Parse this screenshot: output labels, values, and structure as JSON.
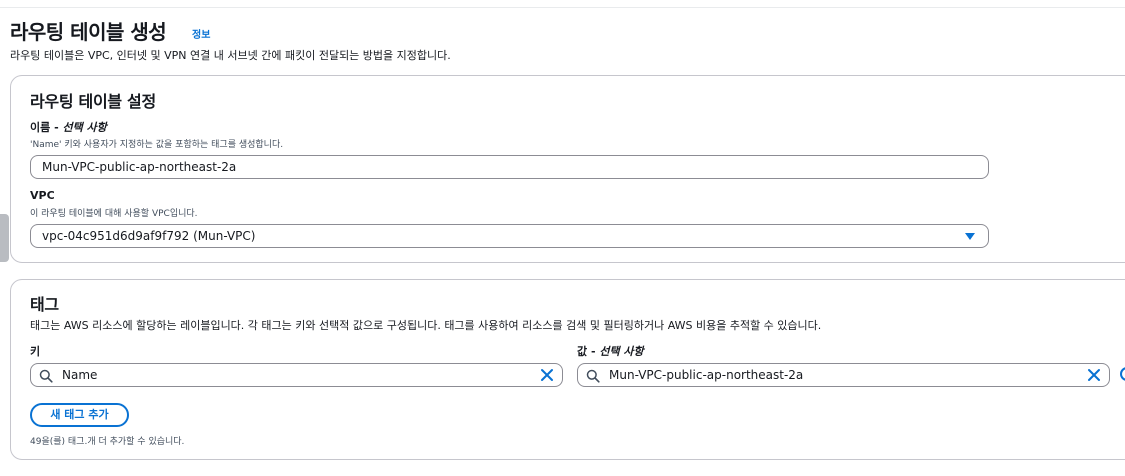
{
  "header": {
    "title": "라우팅 테이블 생성",
    "info_link": "정보",
    "description": "라우팅 테이블은 VPC, 인터넷 및 VPN 연결 내 서브넷 간에 패킷이 전달되는 방법을 지정합니다."
  },
  "settings": {
    "title": "라우팅 테이블 설정",
    "name_label": "이름 - ",
    "name_optional": "선택 사항",
    "name_hint": "'Name' 키와 사용자가 지정하는 값을 포함하는 태그를 생성합니다.",
    "name_value": "Mun-VPC-public-ap-northeast-2a",
    "vpc_label": "VPC",
    "vpc_hint": "이 라우팅 테이블에 대해 사용할 VPC입니다.",
    "vpc_value": "vpc-04c951d6d9af9f792 (Mun-VPC)"
  },
  "tags": {
    "title": "태그",
    "description": "태그는 AWS 리소스에 할당하는 레이블입니다. 각 태그는 키와 선택적 값으로 구성됩니다. 태그를 사용하여 리소스를 검색 및 필터링하거나 AWS 비용을 추적할 수 있습니다.",
    "key_label": "키",
    "value_label": "값 - ",
    "value_optional": "선택 사항",
    "key_value": "Name",
    "value_value": "Mun-VPC-public-ap-northeast-2a",
    "add_button": "새 태그 추가",
    "remaining_hint": "49을(를) 태그.개 더 추가할 수 있습니다."
  },
  "colors": {
    "accent": "#0972d3",
    "border": "#8c8c94",
    "text": "#16191f"
  }
}
